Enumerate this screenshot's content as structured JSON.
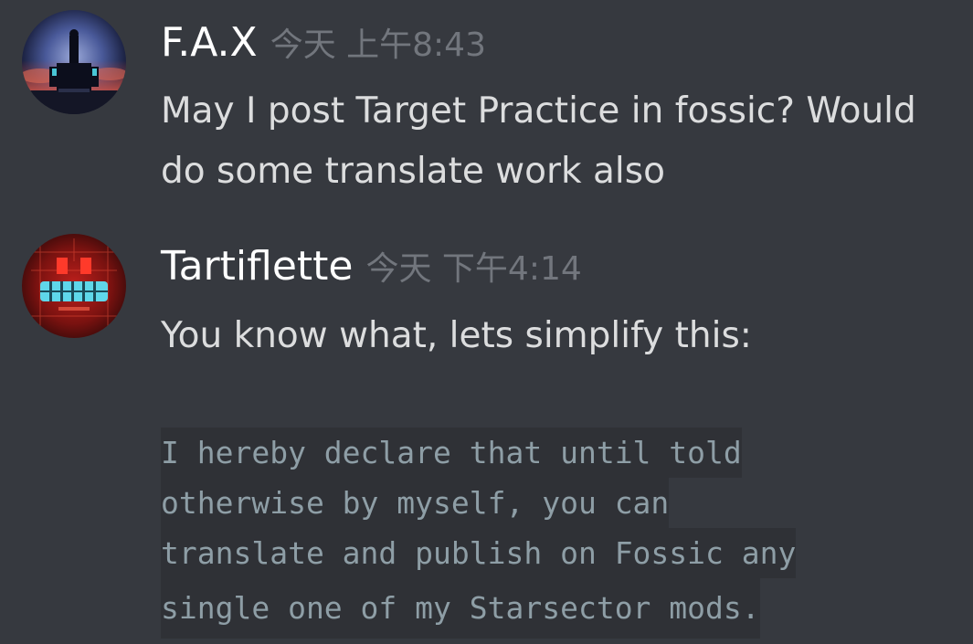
{
  "messages": [
    {
      "username": "F.A.X",
      "timestamp": "今天 上午8:43",
      "lines": [
        "May I post Target Practice in fossic? Would",
        "do some translate work also"
      ]
    },
    {
      "username": "Tartiflette",
      "timestamp": "今天 下午4:14",
      "lines": [
        "You know what, lets simplify this:"
      ],
      "code_lines": [
        "I hereby declare that until told",
        "otherwise by myself, you can",
        "translate and publish on Fossic any",
        "single one of my Starsector mods."
      ]
    }
  ],
  "colors": {
    "background": "#36393f",
    "username": "#ffffff",
    "timestamp": "#72767d",
    "text": "#dcddde",
    "code_background": "#2f3136",
    "code_text": "#8e9ea6"
  }
}
